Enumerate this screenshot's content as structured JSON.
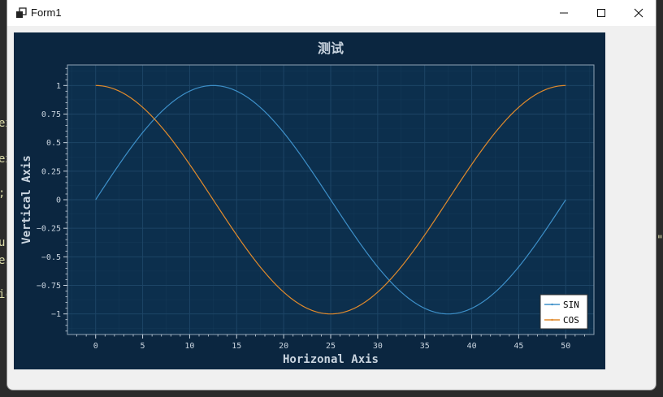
{
  "window": {
    "title": "Form1"
  },
  "icons": {
    "app": "app-icon",
    "minimize": "minimize-icon",
    "maximize": "maximize-icon",
    "close": "close-icon"
  },
  "background_code": {
    "left_fragments": [
      "ex",
      "ex",
      ";",
      "u",
      "es",
      "ic"
    ],
    "right_fragments": [
      "\""
    ]
  },
  "colors": {
    "figure_bg": "#0b2640",
    "plot_bg": "#0c2f4d",
    "grid": "#1d4566",
    "axis_text": "#c9d4df",
    "sin": "#3d8fc8",
    "cos": "#e08a2c"
  },
  "chart_data": {
    "type": "line",
    "title": "测试",
    "xlabel": "Horizonal Axis",
    "ylabel": "Vertical Axis",
    "xlim": [
      -3,
      53
    ],
    "ylim": [
      -1.18,
      1.18
    ],
    "xticks": [
      0,
      5,
      10,
      15,
      20,
      25,
      30,
      35,
      40,
      45,
      50
    ],
    "yticks": [
      1,
      0.75,
      0.5,
      0.25,
      0,
      -0.25,
      -0.5,
      -0.75,
      -1
    ],
    "ytick_labels": [
      "1",
      "0.75",
      "0.5",
      "0.25",
      "0",
      "−0.25",
      "−0.5",
      "−0.75",
      "−1"
    ],
    "grid": true,
    "legend": "bottom-right",
    "series": [
      {
        "name": "SIN",
        "x_range": [
          0,
          50
        ],
        "period": 50,
        "func": "sin",
        "color": "#3d8fc8"
      },
      {
        "name": "COS",
        "x_range": [
          0,
          50
        ],
        "period": 50,
        "func": "cos",
        "color": "#e08a2c"
      }
    ]
  }
}
